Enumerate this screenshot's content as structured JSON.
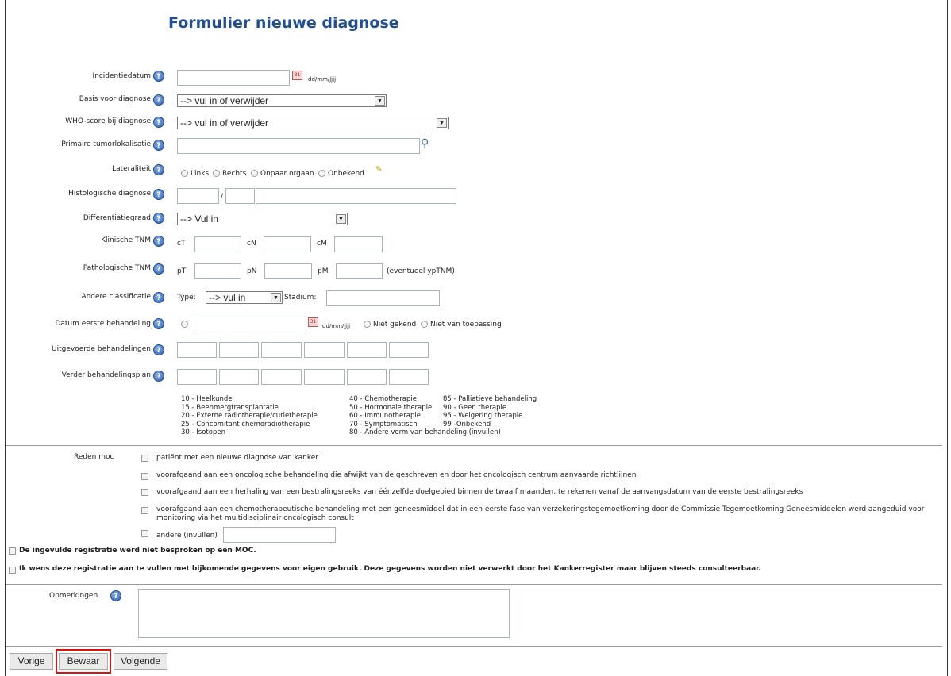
{
  "title": "Formulier nieuwe diagnose",
  "fields": {
    "incidentiedatum": "Incidentiedatum",
    "basis": "Basis voor diagnose",
    "who": "WHO-score bij diagnose",
    "primaire": "Primaire tumorlokalisatie",
    "lateraliteit": "Lateraliteit",
    "histologische": "Histologische diagnose",
    "differentiatie": "Differentiatiegraad",
    "klinische": "Klinische TNM",
    "pathologische": "Pathologische TNM",
    "andere": "Andere classificatie",
    "datum_eerste": "Datum eerste behandeling",
    "uitgevoerde": "Uitgevoerde behandelingen",
    "verder": "Verder behandelingsplan"
  },
  "date_format": "dd/mm/jjjj",
  "select_fill_or_remove": "--> vul in of verwijder",
  "select_fill_in": "--> Vul in",
  "select_vul_in": "--> vul in",
  "lateraliteit_options": [
    "Links",
    "Rechts",
    "Onpaar orgaan",
    "Onbekend"
  ],
  "histo_separator": "/",
  "tnm": {
    "clinical": [
      "cT",
      "cN",
      "cM"
    ],
    "path": [
      "pT",
      "pN",
      "pM"
    ],
    "path_note": "(eventueel ypTNM)"
  },
  "andere_type": "Type:",
  "andere_stadium": "Stadium:",
  "datum_opts": [
    "Niet gekend",
    "Niet van toepassing"
  ],
  "codes": {
    "col1": [
      "10 - Heelkunde",
      "15 - Beenmergtransplantatie",
      "20 - Externe radiotherapie/curietherapie",
      "25 - Concomitant chemoradiotherapie",
      "30 - Isotopen"
    ],
    "col2": [
      "40 - Chemotherapie",
      "50 - Hormonale therapie",
      "60 - Immunotherapie",
      "70 - Symptomatisch",
      "80 - Andere vorm van behandeling (invullen)"
    ],
    "col3": [
      "85 - Palliatieve behandeling",
      "90 - Geen therapie",
      "95 - Weigering therapie",
      "99 -Onbekend"
    ]
  },
  "reden": {
    "label": "Reden moc",
    "options": [
      "patiënt met een nieuwe diagnose van kanker",
      "voorafgaand aan een oncologische behandeling die afwijkt van de geschreven en door het oncologisch centrum aanvaarde richtlijnen",
      "voorafgaand aan een herhaling van een bestralingsreeks van éénzelfde doelgebied binnen de twaalf maanden, te rekenen vanaf de aanvangsdatum van de eerste bestralingsreeks",
      "voorafgaand aan een chemotherapeutische behandeling met een geneesmiddel dat in een eerste fase van verzekeringstegemoetkoming door de Commissie Tegemoetkoming Geneesmiddelen werd aangeduid voor",
      "monitoring via het multidisciplinair oncologisch consult",
      "andere (invullen)"
    ]
  },
  "check_moc": "De ingevulde registratie werd niet besproken op een MOC.",
  "check_extra": "Ik wens deze registratie aan te vullen met bijkomende gegevens voor eigen gebruik. Deze gegevens worden niet verwerkt door het Kankerregister maar blijven steeds consulteerbaar.",
  "opmerkingen": "Opmerkingen",
  "buttons": {
    "vorige": "Vorige",
    "bewaar": "Bewaar",
    "volgende": "Volgende"
  },
  "colors": {
    "title": "#1f4e96",
    "highlight": "#dd1111"
  }
}
